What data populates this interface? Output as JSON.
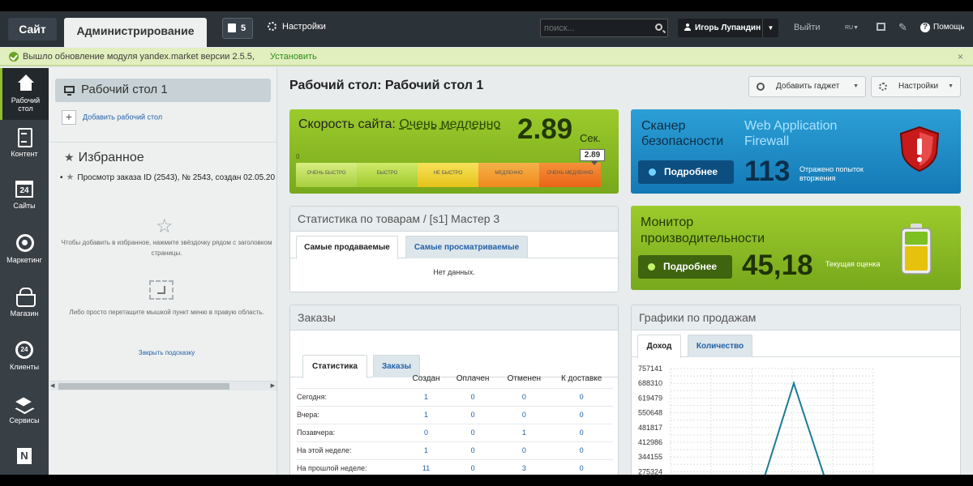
{
  "topbar": {
    "site_label": "Сайт",
    "admin_label": "Администрирование",
    "notify_count": "5",
    "settings_label": "Настройки",
    "search_placeholder": "поиск...",
    "user_name": "Игорь Лупандин",
    "exit_label": "Выйти",
    "lang": "RU",
    "help_label": "Помощь"
  },
  "update_bar": {
    "message": "Вышло обновление модуля yandex.market версии 2.5.5,",
    "install_label": "Установить",
    "close": "×"
  },
  "nav": {
    "items": [
      {
        "label_1": "Рабочий",
        "label_2": "стол",
        "icon": "home-icon"
      },
      {
        "label_1": "Контент",
        "icon": "document-icon"
      },
      {
        "label_1": "Сайты",
        "icon": "calendar-24-icon",
        "badge": "24"
      },
      {
        "label_1": "Маркетинг",
        "icon": "target-icon"
      },
      {
        "label_1": "Магазин",
        "icon": "basket-icon"
      },
      {
        "label_1": "Клиенты",
        "icon": "clients-24-icon",
        "badge": "24"
      },
      {
        "label_1": "Сервисы",
        "icon": "layers-icon"
      },
      {
        "label_1": "",
        "icon": "n-logo-icon",
        "badge": "N"
      }
    ]
  },
  "left_panel": {
    "desktop_item": "Рабочий стол 1",
    "add_desktop": "Добавить рабочий стол",
    "favorites_title": "Избранное",
    "favorite_row": "Просмотр заказа ID (2543), № 2543, создан 02.05.20",
    "hint_1": "Чтобы добавить в избранное, нажмите звёздочку рядом с заголовком страницы.",
    "hint_2": "Либо просто перетащите мышкой пункт меню в правую область.",
    "close_hint": "Закрыть подсказку"
  },
  "main": {
    "page_title": "Рабочий стол: Рабочий стол 1",
    "add_gadget": "Добавить гаджет",
    "settings": "Настройки"
  },
  "speed_widget": {
    "title": "Скорость сайта:",
    "status": "Очень медленно",
    "value": "2.89",
    "unit": "Сек.",
    "zero": "0",
    "badge": "2.89",
    "scale": [
      "ОЧЕНЬ БЫСТРО",
      "БЫСТРО",
      "НЕ БЫСТРО",
      "МЕДЛЕННО",
      "ОЧЕНЬ МЕДЛЕННО"
    ],
    "colors": {
      "good": "#9ccb2c",
      "warn": "#e6c21a",
      "bad": "#ea6418"
    }
  },
  "scanner_widget": {
    "title": "Сканер безопасности",
    "subtitle": "Web Application Firewall",
    "button": "Подробнее",
    "value": "113",
    "caption": "Отражено попыток вторжения",
    "icon": "shield-alert-icon"
  },
  "perf_widget": {
    "title": "Монитор производительности",
    "button": "Подробнее",
    "value": "45,18",
    "caption": "Текущая оценка",
    "icon": "battery-icon"
  },
  "goods_card": {
    "title": "Статистика по товарам / [s1] Мастер 3",
    "tabs": [
      "Самые продаваемые",
      "Самые просматриваемые"
    ],
    "empty": "Нет данных."
  },
  "orders_card": {
    "title": "Заказы",
    "tabs": [
      "Статистика",
      "Заказы"
    ],
    "columns": [
      "",
      "Создан",
      "Оплачен",
      "Отменен",
      "К доставке"
    ],
    "rows": [
      [
        "Сегодня:",
        "1",
        "0",
        "0",
        "0"
      ],
      [
        "Вчера:",
        "1",
        "0",
        "0",
        "0"
      ],
      [
        "Позавчера:",
        "0",
        "0",
        "1",
        "0"
      ],
      [
        "На этой неделе:",
        "1",
        "0",
        "0",
        "0"
      ],
      [
        "На прошлой неделе:",
        "11",
        "0",
        "3",
        "0"
      ]
    ]
  },
  "sales_card": {
    "title": "Графики по продажам",
    "tabs": [
      "Доход",
      "Количество"
    ]
  },
  "chart_data": {
    "type": "line",
    "y_ticks": [
      "757141",
      "688310",
      "619479",
      "550648",
      "481817",
      "412986",
      "344155",
      "275324"
    ],
    "ylim": [
      275324,
      757141
    ],
    "series": [
      {
        "values": [
          180000,
          688310,
          180000
        ],
        "color": "#1c7c93"
      }
    ],
    "grid": true
  }
}
